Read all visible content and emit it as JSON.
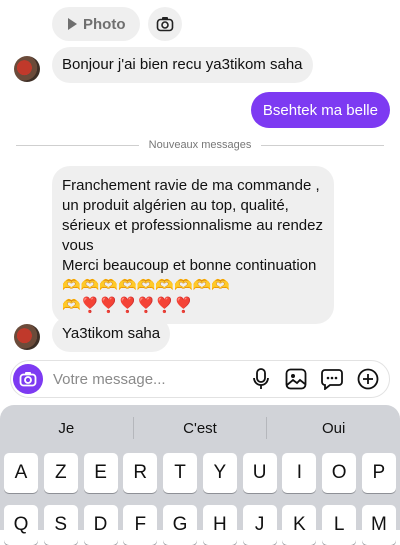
{
  "thread": {
    "photo_label": "Photo",
    "greeting": "Bonjour j'ai bien recu ya3tikom saha",
    "sent": "Bsehtek ma belle",
    "divider": "Nouveaux messages",
    "review": {
      "line1": "Franchement ravie de ma commande ,",
      "line2": "un produit algérien au top, qualité,",
      "line3": "sérieux et professionnalisme au rendez",
      "line4": "vous",
      "line5": "Merci beaucoup et bonne continuation",
      "emoji_row1": "🫶🫶🫶🫶🫶🫶🫶🫶🫶",
      "emoji_row2": "🫶❣️❣️❣️❣️❣️❣️"
    },
    "last": "Ya3tikom saha"
  },
  "composer": {
    "placeholder": "Votre message..."
  },
  "keyboard": {
    "suggestions": [
      "Je",
      "C'est",
      "Oui"
    ],
    "row1": [
      "A",
      "Z",
      "E",
      "R",
      "T",
      "Y",
      "U",
      "I",
      "O",
      "P"
    ],
    "row2": [
      "Q",
      "S",
      "D",
      "F",
      "G",
      "H",
      "J",
      "K",
      "L",
      "M"
    ]
  },
  "icons": {
    "camera": "camera-icon",
    "mic": "microphone-icon",
    "gallery": "gallery-icon",
    "sticker": "sticker-icon",
    "plus": "plus-icon"
  },
  "colors": {
    "accent": "#7d3af2",
    "bubble_in": "#efefef"
  }
}
